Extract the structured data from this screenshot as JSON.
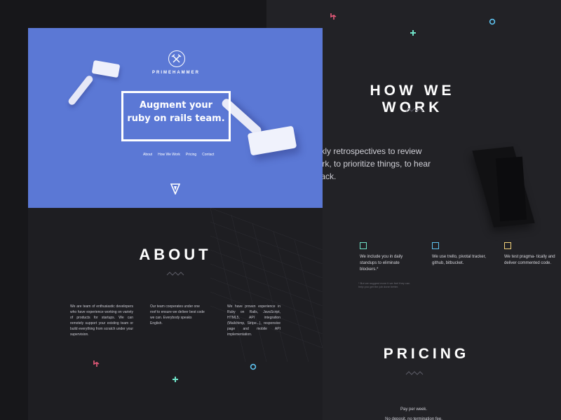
{
  "brand": {
    "name": "PRIMEHAMMER"
  },
  "hero": {
    "headline_line1": "Augment your",
    "headline_line2": "ruby on rails team.",
    "nav": [
      "About",
      "How We Work",
      "Pricing",
      "Contact"
    ]
  },
  "about": {
    "title": "ABOUT",
    "col1": "We are team of enthusiastic developers who have experience working on variety of products for startups. We can remotely support your existing team or build everything from scratch under your supervision.",
    "col2": "Our team cooperates under one roof to ensure we deliver best code we can. Everybody speaks English.",
    "col3": "We have proven experience in Ruby on Rails, JavaScript, HTML5, API integration (Mailchimp, Stripe...), responsive page and mobile API implementation."
  },
  "how": {
    "title": "HOW WE WORK",
    "line1": "eekly retrospectives to review",
    "line2": "work, to prioritize things, to hear",
    "line3": "dback."
  },
  "features": [
    {
      "text": "We include you in daily standups to eliminate blockers.*",
      "color": "#6fe3c8",
      "icon": "square-bracket-icon"
    },
    {
      "text": "We use trello, pivotal tracker, github, bitbucket.",
      "color": "#5ec3f0",
      "icon": "square-bracket-icon"
    },
    {
      "text": "We test pragma- tically and deliver commented code.",
      "color": "#f3d27a",
      "icon": "square-bracket-icon"
    }
  ],
  "feature_note": "* But we suggest more it we feel they can help you get the job done better.",
  "pricing": {
    "title": "PRICING",
    "line1": "Pay per week.",
    "line2": "No deposit, no termination fee."
  },
  "colors": {
    "hero_blue": "#5b78d5",
    "accent_pink": "#e85a7a",
    "accent_mint": "#6fe3c8",
    "accent_cyan": "#5ec3f0",
    "accent_yellow": "#f3d27a"
  }
}
